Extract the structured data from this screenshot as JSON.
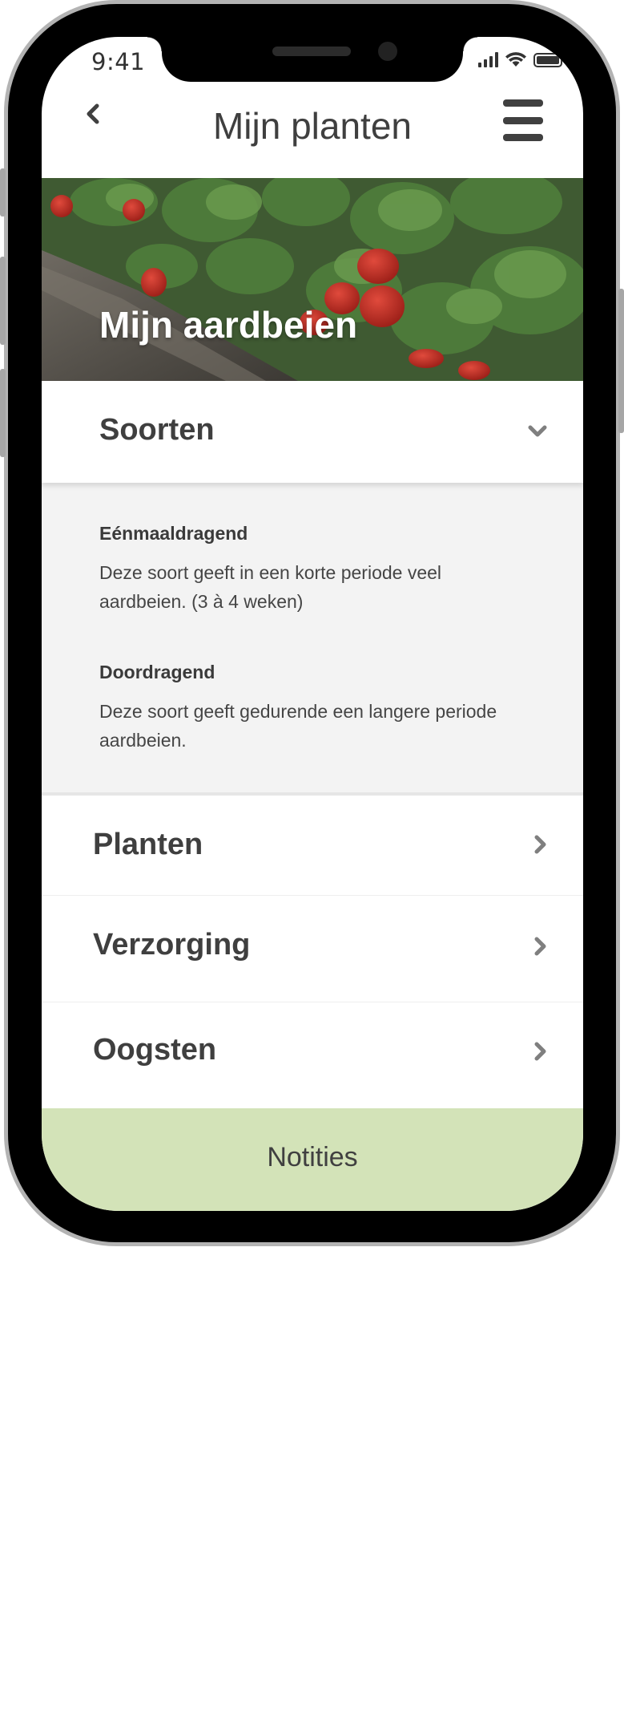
{
  "status_bar": {
    "time": "9:41"
  },
  "nav": {
    "title": "Mijn planten"
  },
  "hero": {
    "title": "Mijn aardbeien"
  },
  "accordion": {
    "title": "Soorten",
    "entries": [
      {
        "heading": "Eénmaaldragend",
        "text": "Deze soort geeft in een korte periode veel aardbeien. (3 à 4 weken)"
      },
      {
        "heading": "Doordragend",
        "text": "Deze soort geeft  gedurende een langere periode aardbeien."
      }
    ]
  },
  "menu_items": [
    {
      "label": "Planten"
    },
    {
      "label": "Verzorging"
    },
    {
      "label": "Oogsten"
    }
  ],
  "notes": {
    "label": "Notities"
  },
  "colors": {
    "notes_bg": "#d3e3b8",
    "text": "#404040"
  },
  "icons": [
    "back-chevron-icon",
    "hamburger-menu-icon",
    "chevron-down-icon",
    "chevron-right-icon",
    "signal-icon",
    "wifi-icon",
    "battery-icon"
  ]
}
